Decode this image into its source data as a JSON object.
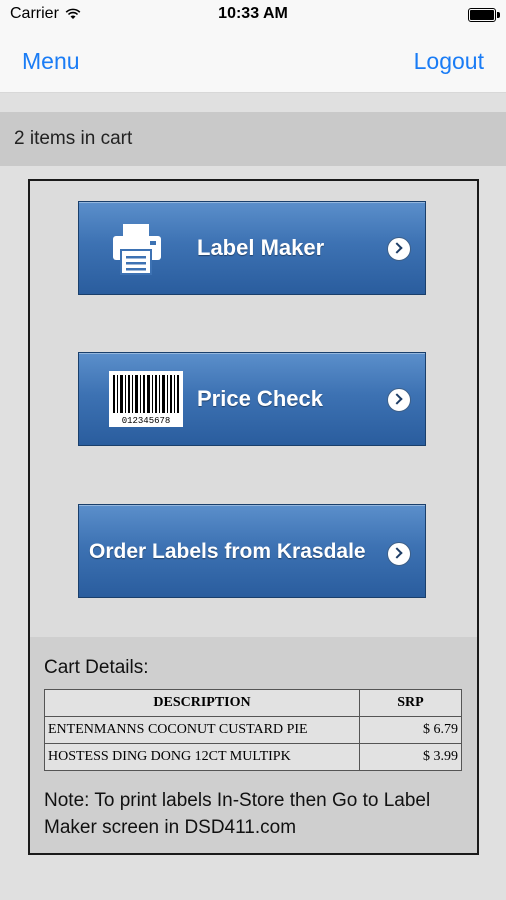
{
  "status": {
    "carrier": "Carrier",
    "time": "10:33 AM"
  },
  "nav": {
    "menu": "Menu",
    "logout": "Logout"
  },
  "cart_summary": "2 items in cart",
  "buttons": {
    "label_maker": "Label Maker",
    "price_check": "Price Check",
    "barcode_number": "012345678",
    "order_labels": "Order Labels from Krasdale"
  },
  "cart_details": {
    "title": "Cart Details:",
    "columns": [
      "DESCRIPTION",
      "SRP"
    ],
    "rows": [
      {
        "description": "ENTENMANNS COCONUT CUSTARD PIE",
        "srp": "$ 6.79"
      },
      {
        "description": "HOSTESS DING DONG 12CT MULTIPK",
        "srp": "$ 3.99"
      }
    ],
    "note": "Note: To print labels In-Store then Go to Label Maker screen in DSD411.com"
  }
}
